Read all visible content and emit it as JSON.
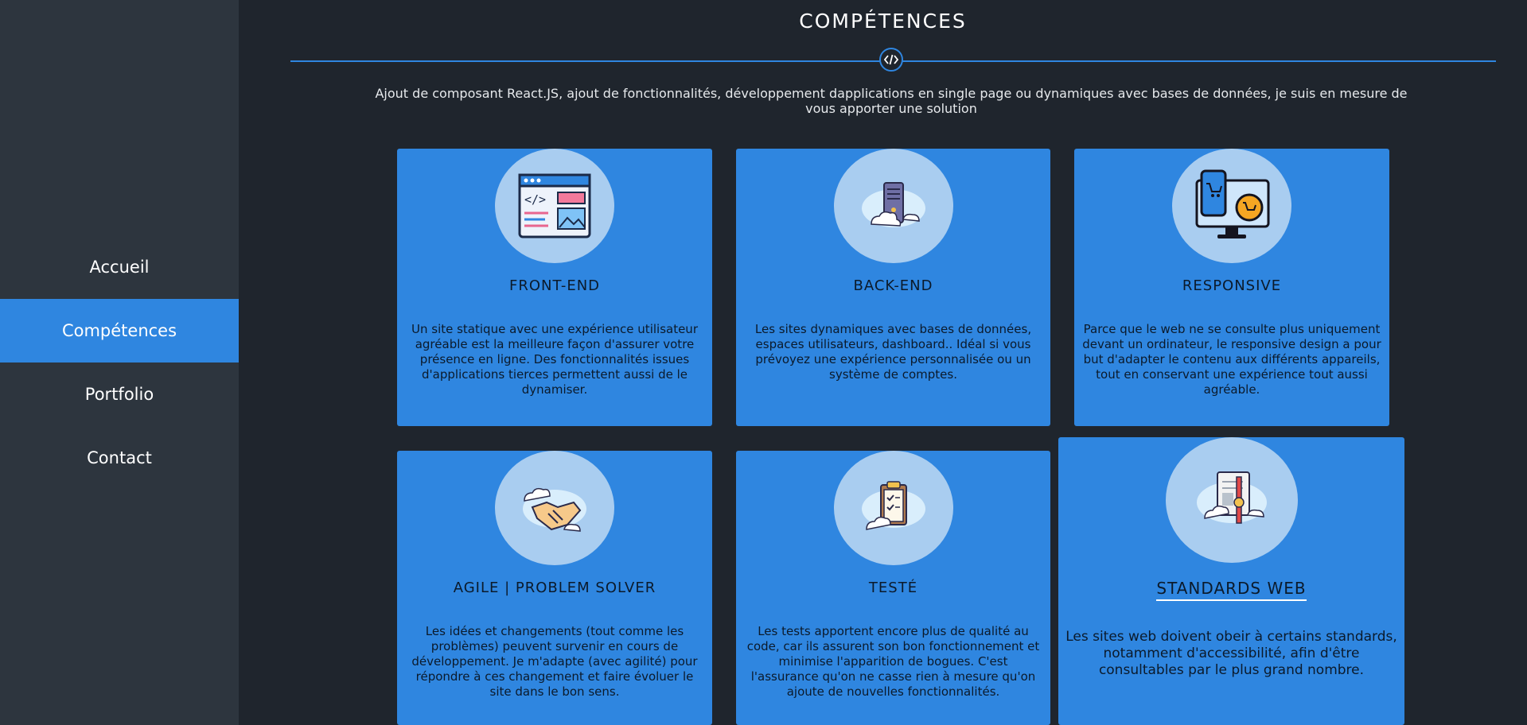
{
  "sidebar": {
    "items": [
      {
        "label": "Accueil",
        "active": false
      },
      {
        "label": "Compétences",
        "active": true
      },
      {
        "label": "Portfolio",
        "active": false
      },
      {
        "label": "Contact",
        "active": false
      }
    ]
  },
  "main": {
    "title": "COMPÉTENCES",
    "divider_icon": "code-icon",
    "intro": "Ajout de composant React.JS, ajout de fonctionnalités, développement dapplications en single page ou dynamiques avec bases de données, je suis en mesure de vous apporter une solution",
    "cards": [
      {
        "icon": "web-code-icon",
        "title": "FRONT-END",
        "text": "Un site statique avec une expérience utilisateur agréable est la meilleure façon d'assurer votre présence en ligne. Des fonctionnalités issues d'applications tierces permettent aussi de le dynamiser."
      },
      {
        "icon": "cloud-server-icon",
        "title": "BACK-END",
        "text": "Les sites dynamiques avec bases de données, espaces utilisateurs, dashboard.. Idéal si vous prévoyez une expérience personnalisée ou un système de comptes."
      },
      {
        "icon": "responsive-devices-icon",
        "title": "RESPONSIVE",
        "text": "Parce que le web ne se consulte plus uniquement devant un ordinateur, le responsive design a pour but d'adapter le contenu aux différents appareils, tout en conservant une expérience tout aussi agréable."
      },
      {
        "icon": "handshake-icon",
        "title": "AGILE | PROBLEM SOLVER",
        "text": "Les idées et changements (tout comme les problèmes) peuvent survenir en cours de développement. Je m'adapte (avec agilité) pour répondre à ces changement et faire évoluer le site dans le bon sens."
      },
      {
        "icon": "clipboard-check-icon",
        "title": "TESTÉ",
        "text": "Les tests apportent encore plus de qualité au code, car ils assurent son bon fonctionnement et minimise l'apparition de bogues. C'est l'assurance qu'on ne casse rien à mesure qu'on ajoute de nouvelles fonctionnalités."
      },
      {
        "icon": "certificate-icon",
        "title": "STANDARDS WEB",
        "text": "Les sites web doivent obeir à certains standards, notamment d'accessibilité, afin d'être consultables par le plus grand nombre."
      }
    ]
  },
  "colors": {
    "accent": "#2f86e0",
    "background": "#1f252d",
    "sidebar": "#2d353e",
    "circle": "#a9cdf0"
  }
}
